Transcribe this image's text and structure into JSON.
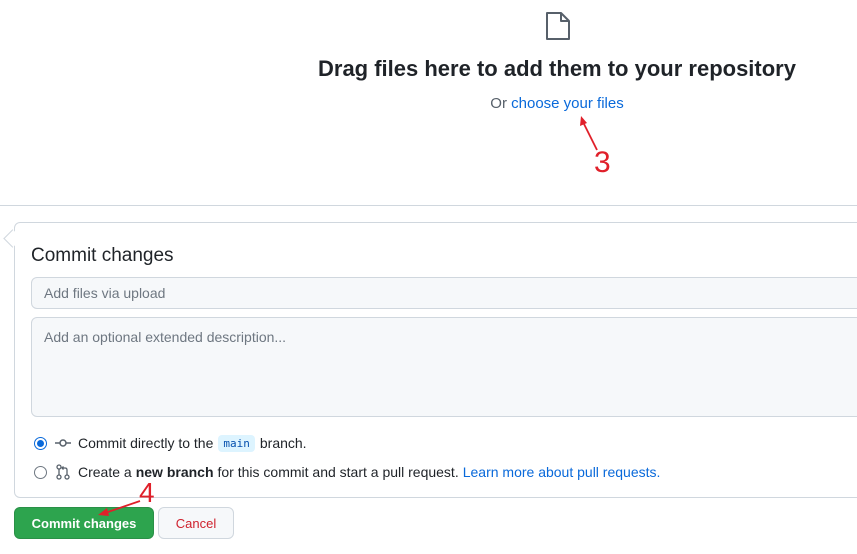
{
  "upload": {
    "icon": "file-icon",
    "title": "Drag files here to add them to your repository",
    "or_text": "Or",
    "choose_link": "choose your files"
  },
  "commit": {
    "title": "Commit changes",
    "summary_placeholder": "Add files via upload",
    "description_placeholder": "Add an optional extended description...",
    "option_direct": {
      "prefix": "Commit directly to the",
      "branch": "main",
      "suffix": "branch.",
      "selected": true
    },
    "option_new_branch": {
      "prefix": "Create a",
      "bold": "new branch",
      "suffix": "for this commit and start a pull request.",
      "link": "Learn more about pull requests.",
      "selected": false
    },
    "commit_button": "Commit changes",
    "cancel_button": "Cancel"
  },
  "annotations": {
    "step3": "3",
    "step4": "4",
    "color": "#e0202a"
  },
  "colors": {
    "primary_button": "#2da44e",
    "link": "#0969da",
    "cancel_text": "#cf222e"
  }
}
